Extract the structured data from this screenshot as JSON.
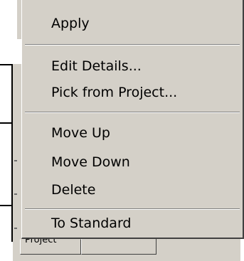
{
  "menu": {
    "items": [
      {
        "label": "Apply"
      },
      {
        "label": "Edit Details..."
      },
      {
        "label": "Pick from Project..."
      },
      {
        "label": "Move Up"
      },
      {
        "label": "Move Down"
      },
      {
        "label": "Delete"
      },
      {
        "label": "To Standard"
      }
    ]
  },
  "tabs": {
    "project_label": "Project",
    "other_label": ""
  },
  "colors": {
    "menu_background": "#d4d0c8",
    "separator_dark": "#808080",
    "separator_light": "#ffffff",
    "text": "#000000"
  }
}
